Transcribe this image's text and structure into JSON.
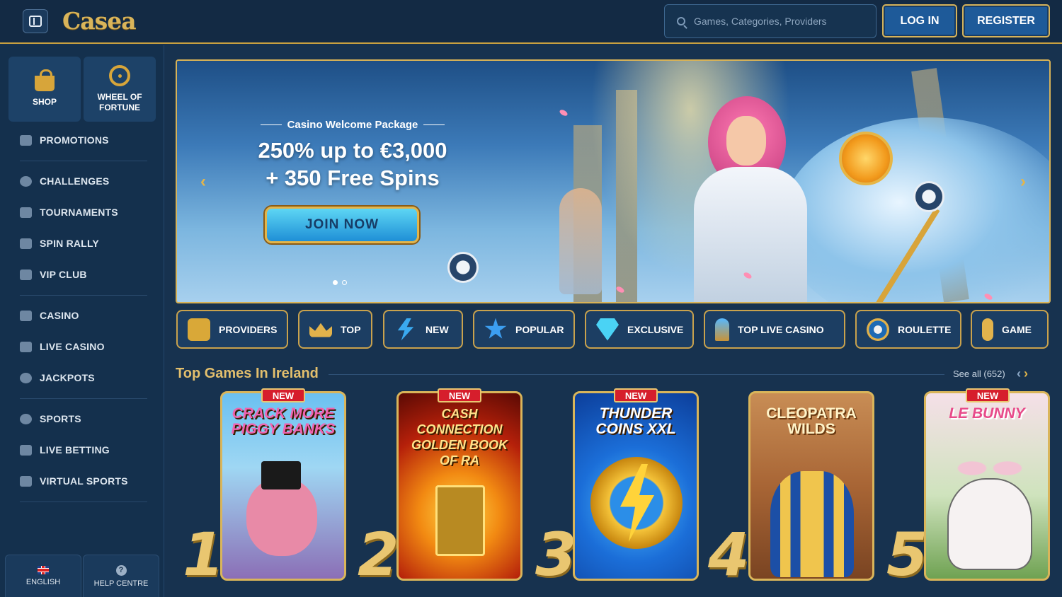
{
  "header": {
    "logo": "Casea",
    "search_placeholder": "Games, Categories, Providers",
    "login_label": "LOG IN",
    "register_label": "REGISTER"
  },
  "sidebar": {
    "tiles": [
      {
        "label": "SHOP",
        "icon": "shopping-bag-icon"
      },
      {
        "label": "WHEEL OF FORTUNE",
        "icon": "wheel-icon"
      }
    ],
    "items": [
      {
        "label": "PROMOTIONS",
        "icon": "gift-icon"
      },
      {
        "label": "CHALLENGES",
        "icon": "medal-icon"
      },
      {
        "label": "TOURNAMENTS",
        "icon": "trophy-icon"
      },
      {
        "label": "SPIN RALLY",
        "icon": "flag-icon"
      },
      {
        "label": "VIP CLUB",
        "icon": "diamond-icon"
      },
      {
        "label": "CASINO",
        "icon": "slot-machine-icon"
      },
      {
        "label": "LIVE CASINO",
        "icon": "phone-cards-icon"
      },
      {
        "label": "JACKPOTS",
        "icon": "clover-icon"
      },
      {
        "label": "SPORTS",
        "icon": "ball-icon"
      },
      {
        "label": "LIVE BETTING",
        "icon": "live-icon"
      },
      {
        "label": "VIRTUAL SPORTS",
        "icon": "monitor-icon"
      }
    ],
    "footer": {
      "language_label": "ENGLISH",
      "help_label": "HELP CENTRE"
    }
  },
  "banner": {
    "subtitle": "Casino Welcome Package",
    "headline_line1": "250% up to €3,000",
    "headline_line2": "+ 350 Free Spins",
    "cta_label": "JOIN NOW",
    "slide_count": 2,
    "active_slide": 1
  },
  "categories": [
    {
      "label": "PROVIDERS",
      "icon": "card-icon"
    },
    {
      "label": "TOP",
      "icon": "crown-icon"
    },
    {
      "label": "NEW",
      "icon": "lightning-icon"
    },
    {
      "label": "POPULAR",
      "icon": "star-icon"
    },
    {
      "label": "EXCLUSIVE",
      "icon": "gem-icon"
    },
    {
      "label": "TOP LIVE CASINO",
      "icon": "torch-icon"
    },
    {
      "label": "ROULETTE",
      "icon": "roulette-icon"
    },
    {
      "label": "GAME",
      "icon": "microphone-icon"
    }
  ],
  "section": {
    "title": "Top Games In Ireland",
    "see_all": "See all (652)"
  },
  "games": [
    {
      "rank": "1",
      "badge": "NEW",
      "title": "CRACK MORE PIGGY BANKS"
    },
    {
      "rank": "2",
      "badge": "NEW",
      "title": "CASH CONNECTION GOLDEN BOOK OF RA"
    },
    {
      "rank": "3",
      "badge": "NEW",
      "title": "THUNDER COINS XXL"
    },
    {
      "rank": "4",
      "badge": "",
      "title": "CLEOPATRA WILDS"
    },
    {
      "rank": "5",
      "badge": "NEW",
      "title": "LE BUNNY"
    }
  ],
  "colors": {
    "background": "#17324f",
    "gold": "#d9b55a",
    "button_blue": "#1e5a99",
    "badge_red": "#d61e2c"
  }
}
